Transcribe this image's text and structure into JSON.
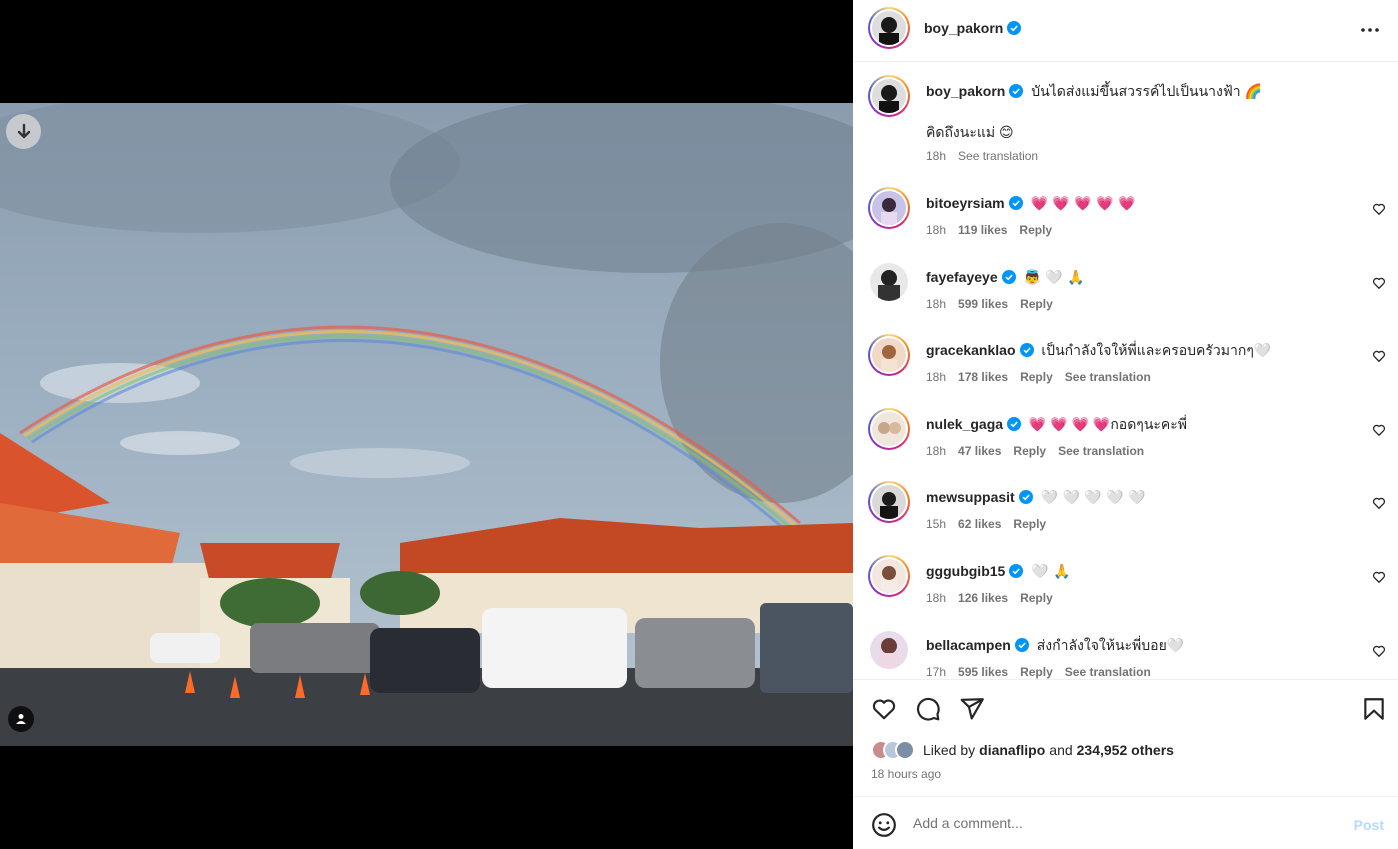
{
  "post": {
    "author": "boy_pakorn",
    "caption": "บันไดส่งแม่ขึ้นสวรรค์ไปเป็นนางฟ้า 🌈",
    "caption_line2": "คิดถึงนะแม่ 😊",
    "time": "18h",
    "see_translation": "See translation",
    "likes_prefix": "Liked by",
    "liked_by_user": "dianaflipo",
    "likes_and": "and",
    "likes_others": "234,952 others",
    "time_ago": "18 hours ago"
  },
  "comments": [
    {
      "user": "bitoeyrsiam",
      "text": "💗 💗 💗 💗 💗",
      "time": "18h",
      "likes": "119 likes",
      "reply": "Reply",
      "translate": ""
    },
    {
      "user": "fayefayeye",
      "text": "👼 🤍 🙏",
      "time": "18h",
      "likes": "599 likes",
      "reply": "Reply",
      "translate": ""
    },
    {
      "user": "gracekanklao",
      "text": "เป็นกำลังใจให้พี่และครอบครัวมากๆ🤍",
      "time": "18h",
      "likes": "178 likes",
      "reply": "Reply",
      "translate": "See translation"
    },
    {
      "user": "nulek_gaga",
      "text": "💗 💗 💗 💗กอดๆนะคะพี่",
      "time": "18h",
      "likes": "47 likes",
      "reply": "Reply",
      "translate": "See translation"
    },
    {
      "user": "mewsuppasit",
      "text": "🤍 🤍 🤍 🤍 🤍",
      "time": "15h",
      "likes": "62 likes",
      "reply": "Reply",
      "translate": ""
    },
    {
      "user": "gggubgib15",
      "text": "🤍 🙏",
      "time": "18h",
      "likes": "126 likes",
      "reply": "Reply",
      "translate": ""
    },
    {
      "user": "bellacampen",
      "text": "ส่งกำลังใจให้นะพี่บอย🤍",
      "time": "17h",
      "likes": "595 likes",
      "reply": "Reply",
      "translate": "See translation"
    }
  ],
  "composer": {
    "placeholder": "Add a comment...",
    "post_label": "Post"
  },
  "icons": {
    "more": "more-horizontal-icon",
    "like": "heart-icon",
    "comment": "comment-icon",
    "share": "send-icon",
    "save": "bookmark-icon",
    "emoji": "emoji-icon",
    "download": "download-icon",
    "tag": "user-tag-icon",
    "verified": "verified-badge-icon"
  },
  "colors": {
    "verified": "#0095f6",
    "post_button": "#b3dbff"
  }
}
